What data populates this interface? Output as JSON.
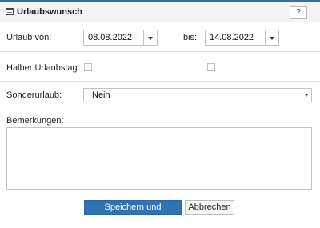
{
  "dialog": {
    "title": "Urlaubswunsch",
    "help_label": "?",
    "title_icon": "calendar-icon",
    "accent_color": "#3b6e9e"
  },
  "form": {
    "vacation_from_label": "Urlaub von:",
    "vacation_from_value": "08.08.2022",
    "to_label": "bis:",
    "vacation_to_value": "14.08.2022",
    "half_day_label": "Halber Urlaubstag:",
    "half_day_from_checked": false,
    "half_day_to_checked": false,
    "special_leave_label": "Sonderurlaub:",
    "special_leave_value": "Nein",
    "remarks_label": "Bemerkungen:",
    "remarks_value": ""
  },
  "buttons": {
    "save_close_label": "Speichern und Schließen",
    "cancel_label": "Abbrechen",
    "primary_color": "#2f73b5"
  }
}
